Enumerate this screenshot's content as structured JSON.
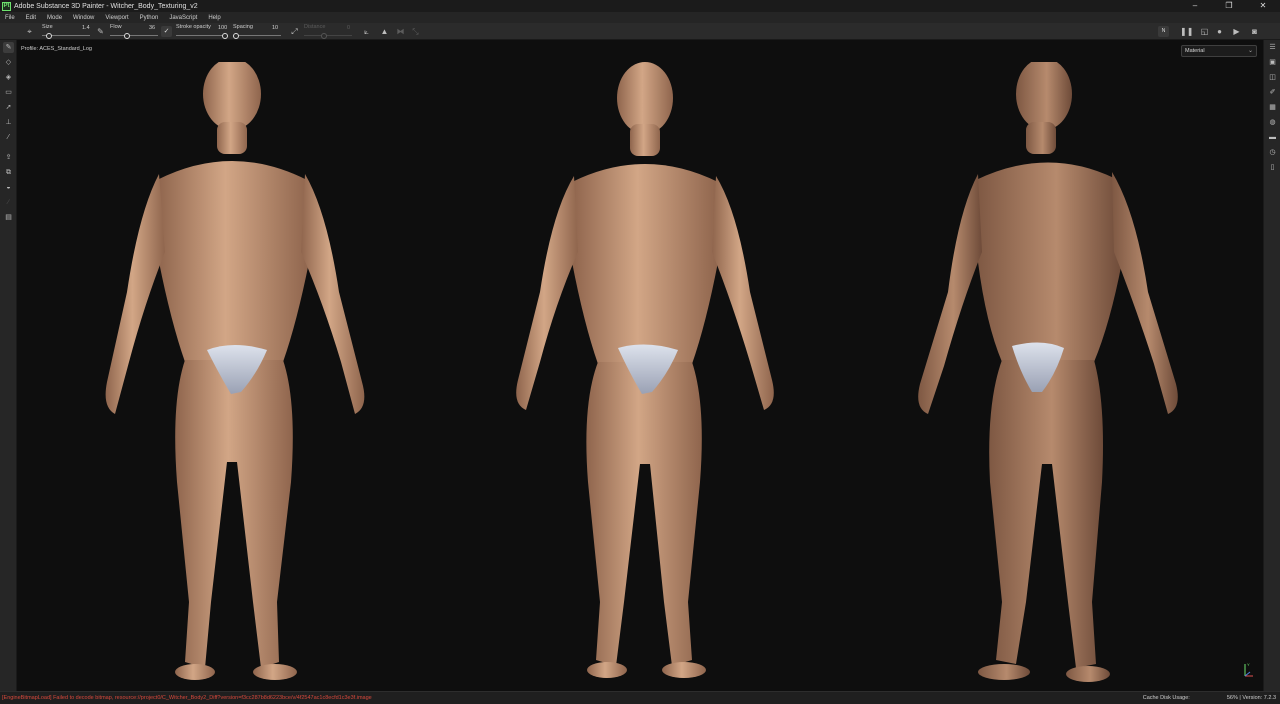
{
  "window": {
    "title": "Adobe Substance 3D Painter - Witcher_Body_Texturing_v2",
    "logo_text": "Pt",
    "minimize_glyph": "–",
    "maximize_glyph": "❐",
    "close_glyph": "✕"
  },
  "menu": [
    "File",
    "Edit",
    "Mode",
    "Window",
    "Viewport",
    "Python",
    "JavaScript",
    "Help"
  ],
  "toolbar": {
    "size_label": "Size",
    "size_value": "1.4",
    "flow_label": "Flow",
    "flow_value": "36",
    "stroke_opacity_label": "Stroke opacity",
    "stroke_opacity_value": "100",
    "spacing_label": "Spacing",
    "spacing_value": "10",
    "distance_label": "Distance",
    "distance_value": "0",
    "symmetry_badge": "N"
  },
  "tools": [
    "brush-icon",
    "eraser-icon",
    "projection-icon",
    "geometry-mask-icon",
    "smudge-icon",
    "clone-icon",
    "color-picker-icon",
    "bake-icon",
    "polygon-fill-icon",
    "transform-icon",
    "measure-icon",
    "properties-icon"
  ],
  "right_panels": [
    "layers-panel-icon",
    "texture-set-icon",
    "layer-stack-icon",
    "brush-settings-icon",
    "display-settings-icon",
    "environment-icon",
    "assets-icon",
    "history-icon",
    "shelf-icon"
  ],
  "viewport": {
    "profile": "Profile: ACES_Standard_Log",
    "channel_select": "Material",
    "channel_chevron": "⌄",
    "axis_y": "Y"
  },
  "status": {
    "error": "[EngineBitmapLoad] Failed to decode bitmap, resource://project0/C_Witcher_Body2_Diff?version=f3cc287b8d6223bce/v/4f2547ac1c8ecfd1c3e3f.image",
    "cache": "Cache Disk Usage:",
    "cache_value": "56%",
    "version": "| Version: 7.2.3"
  },
  "colors": {
    "skin": "#c79a7b",
    "skin_shadow": "#9a6f55",
    "underwear": "#c4cad8",
    "viewport_bg": "#0e0e0e",
    "error_text": "#d6483b"
  }
}
